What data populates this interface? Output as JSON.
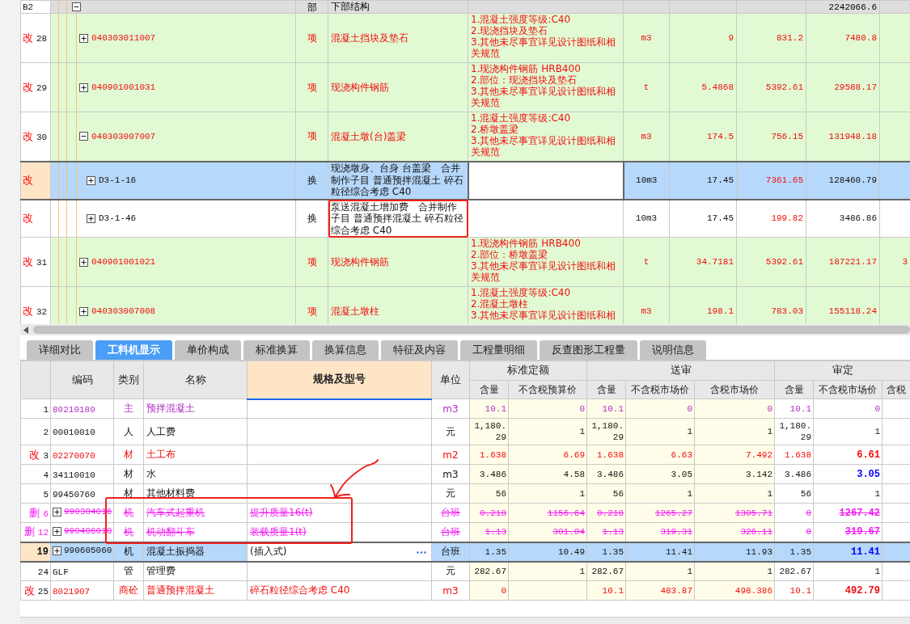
{
  "top_table": {
    "rows": [
      {
        "kind": "section",
        "selected": false,
        "num": "B2",
        "highlighted": false,
        "expanded": true,
        "type": "部",
        "name": "下部结构",
        "total": "2242066.6",
        "children": [
          {
            "kind": "item",
            "selected": false,
            "mark": "改",
            "num": "28",
            "highlighted": false,
            "expanded": false,
            "code": "040303011007",
            "type": "项",
            "name": "混凝土挡块及垫石",
            "feature": "1.混凝土强度等级:C40\n2.现浇挡块及垫石\n3.其他未尽事宜详见设计图纸和相关规范",
            "unit": "m3",
            "qty": "9",
            "price": "831.2",
            "total": "7480.8"
          },
          {
            "kind": "item",
            "selected": false,
            "mark": "改",
            "num": "29",
            "highlighted": false,
            "expanded": false,
            "code": "040901001031",
            "type": "项",
            "name": "现浇构件钢筋",
            "feature": "1.现浇构件钢筋 HRB400\n2.部位：现浇挡块及垫石\n3.其他未尽事宜详见设计图纸和相关规范",
            "unit": "t",
            "qty": "5.4868",
            "price": "5392.61",
            "total": "29588.17"
          },
          {
            "kind": "item",
            "selected": false,
            "mark": "改",
            "num": "30",
            "highlighted": false,
            "expanded": true,
            "code": "040303007007",
            "type": "项",
            "name": "混凝土墩(台)盖梁",
            "feature": "1.混凝土强度等级:C40\n2.桥墩盖梁\n3.其他未尽事宜详见设计图纸和相关规范",
            "unit": "m3",
            "qty": "174.5",
            "price": "756.15",
            "total": "131948.18",
            "children": [
              {
                "kind": "sub",
                "selected": true,
                "mark": "改",
                "expanded": false,
                "code": "D3-1-16",
                "highlighted": false,
                "type": "换",
                "name": "现浇墩身、台身 台盖梁　合并制作子目 普通预拌混凝土 碎石粒径综合考虑 C40",
                "unit": "10m3",
                "qty": "17.45",
                "price": "7361.65",
                "total": "128460.79"
              },
              {
                "kind": "sub",
                "selected": false,
                "mark": "改",
                "expanded": false,
                "code": "D3-1-46",
                "highlighted": true,
                "type": "换",
                "name": "泵送混凝土增加费　合并制作子目 普通预拌混凝土 碎石粒径综合考虑 C40",
                "unit": "10m3",
                "qty": "17.45",
                "price": "199.82",
                "total": "3486.86"
              }
            ]
          },
          {
            "kind": "item",
            "selected": false,
            "mark": "改",
            "num": "31",
            "highlighted": false,
            "expanded": false,
            "code": "040901001021",
            "type": "项",
            "name": "现浇构件钢筋",
            "feature": "1.现浇构件钢筋 HRB400\n2.部位：桥墩盖梁\n3.其他未尽事宜详见设计图纸和相关规范",
            "unit": "t",
            "qty": "34.7181",
            "price": "5392.61",
            "total": "187221.17",
            "column_9": "3"
          },
          {
            "kind": "item",
            "selected": false,
            "mark": "改",
            "num": "32",
            "highlighted": false,
            "expanded": false,
            "code": "040303007008",
            "type": "项",
            "name": "混凝土墩柱",
            "feature": "1.混凝土强度等级:C40\n2.混凝土墩柱\n3.其他未尽事宜详见设计图纸和相",
            "unit": "m3",
            "qty": "198.1",
            "price": "783.03",
            "total": "155118.24"
          }
        ]
      }
    ]
  },
  "tabs": [
    {
      "label": "详细对比",
      "selected": false
    },
    {
      "label": "工料机显示",
      "selected": true
    },
    {
      "label": "单价构成",
      "selected": false
    },
    {
      "label": "标准换算",
      "selected": false
    },
    {
      "label": "换算信息",
      "selected": false
    },
    {
      "label": "特征及内容",
      "selected": false
    },
    {
      "label": "工程量明细",
      "selected": false
    },
    {
      "label": "反查图形工程量",
      "selected": false
    },
    {
      "label": "说明信息",
      "selected": false
    }
  ],
  "bottom_table": {
    "columns": [
      {
        "label": "编码",
        "active": false
      },
      {
        "label": "类别",
        "active": false
      },
      {
        "label": "名称",
        "active": false
      },
      {
        "label": "规格及型号",
        "active": true
      },
      {
        "label": "单位",
        "active": false
      }
    ],
    "groups": [
      {
        "title": "标准定额",
        "columns": [
          "含量",
          "不含税预算价"
        ]
      },
      {
        "title": "送审",
        "columns": [
          "含量",
          "不含税市场价",
          "含税市场价"
        ]
      },
      {
        "title": "审定",
        "columns": [
          "含量",
          "不含税市场价",
          "含税"
        ]
      }
    ],
    "rows": [
      {
        "kind": "main",
        "selected": false,
        "num": "1",
        "code": "80210180",
        "type": "主",
        "name": "预拌混凝土",
        "unit": "m3",
        "values": {
          "std_qty": "10.1",
          "std_price": "0",
          "sub_qty": "10.1",
          "sub_price": "0",
          "sub_tax_price": "0",
          "aud_qty": "10.1",
          "aud_price": "0"
        },
        "audit_emphasis": false
      },
      {
        "kind": "normal",
        "selected": false,
        "num": "2",
        "code": "00010010",
        "type": "人",
        "name": "人工费",
        "unit": "元",
        "values": {
          "std_qty": "1,180.29",
          "std_price": "1",
          "sub_qty": "1,180.29",
          "sub_price": "1",
          "sub_tax_price": "1",
          "aud_qty": "1,180.29",
          "aud_price": "1"
        },
        "audit_emphasis": false
      },
      {
        "kind": "modified",
        "selected": false,
        "mark": "改",
        "num": "3",
        "code": "02270070",
        "type": "材",
        "name": "土工布",
        "unit": "m2",
        "values": {
          "std_qty": "1.638",
          "std_price": "6.69",
          "sub_qty": "1.638",
          "sub_price": "6.63",
          "sub_tax_price": "7.492",
          "aud_qty": "1.638",
          "aud_price": "6.61"
        },
        "audit_emphasis": true
      },
      {
        "kind": "normal",
        "selected": false,
        "num": "4",
        "code": "34110010",
        "type": "材",
        "name": "水",
        "unit": "m3",
        "values": {
          "std_qty": "3.486",
          "std_price": "4.58",
          "sub_qty": "3.486",
          "sub_price": "3.05",
          "sub_tax_price": "3.142",
          "aud_qty": "3.486",
          "aud_price": "3.05"
        },
        "audit_emphasis": true,
        "color": "#0000ff"
      },
      {
        "kind": "normal",
        "selected": false,
        "num": "5",
        "code": "99450760",
        "type": "材",
        "name": "其他材料费",
        "unit": "元",
        "values": {
          "std_qty": "56",
          "std_price": "1",
          "sub_qty": "56",
          "sub_price": "1",
          "sub_tax_price": "1",
          "aud_qty": "56",
          "aud_price": "1"
        },
        "audit_emphasis": false
      },
      {
        "kind": "deleted",
        "selected": false,
        "mark": "删",
        "num": "6",
        "expanded": false,
        "code": "990304016",
        "type": "机",
        "name": "汽车式起重机",
        "spec": "提升质量16(t)",
        "unit": "台班",
        "values": {
          "std_qty": "0.218",
          "std_price": "1156.64",
          "sub_qty": "0.218",
          "sub_price": "1265.27",
          "sub_tax_price": "1305.71",
          "aud_qty": "0",
          "aud_price": "1267.42"
        },
        "audit_emphasis": true
      },
      {
        "kind": "deleted",
        "selected": false,
        "mark": "删",
        "num": "12",
        "expanded": false,
        "code": "990406010",
        "type": "机",
        "name": "机动翻斗车",
        "spec": "装载质量1(t)",
        "unit": "台班",
        "values": {
          "std_qty": "1.13",
          "std_price": "301.04",
          "sub_qty": "1.13",
          "sub_price": "319.31",
          "sub_tax_price": "326.11",
          "aud_qty": "0",
          "aud_price": "319.67"
        },
        "audit_emphasis": true
      },
      {
        "kind": "normal",
        "selected": true,
        "num": "19",
        "expanded": false,
        "code": "990605060",
        "type": "机",
        "name": "混凝土振捣器",
        "spec": "(插入式)",
        "unit": "台班",
        "values": {
          "std_qty": "1.35",
          "std_price": "10.49",
          "sub_qty": "1.35",
          "sub_price": "11.41",
          "sub_tax_price": "11.93",
          "aud_qty": "1.35",
          "aud_price": "11.41"
        },
        "audit_emphasis": true,
        "color": "#0000ff"
      },
      {
        "kind": "normal",
        "selected": false,
        "num": "24",
        "code": "GLF",
        "type": "管",
        "name": "管理费",
        "unit": "元",
        "values": {
          "std_qty": "282.67",
          "std_price": "1",
          "sub_qty": "282.67",
          "sub_price": "1",
          "sub_tax_price": "1",
          "aud_qty": "282.67",
          "aud_price": "1"
        },
        "audit_emphasis": false
      },
      {
        "kind": "modified",
        "selected": false,
        "mark": "改",
        "num": "25",
        "code": "8021907",
        "type": "商砼",
        "name": "普通预拌混凝土",
        "spec": "碎石粒径综合考虑 C40",
        "unit": "m3",
        "values": {
          "std_qty": "0",
          "sub_qty": "10.1",
          "sub_price": "483.87",
          "sub_tax_price": "498.386",
          "aud_qty": "10.1",
          "aud_price": "492.79"
        },
        "audit_emphasis": true
      }
    ]
  }
}
